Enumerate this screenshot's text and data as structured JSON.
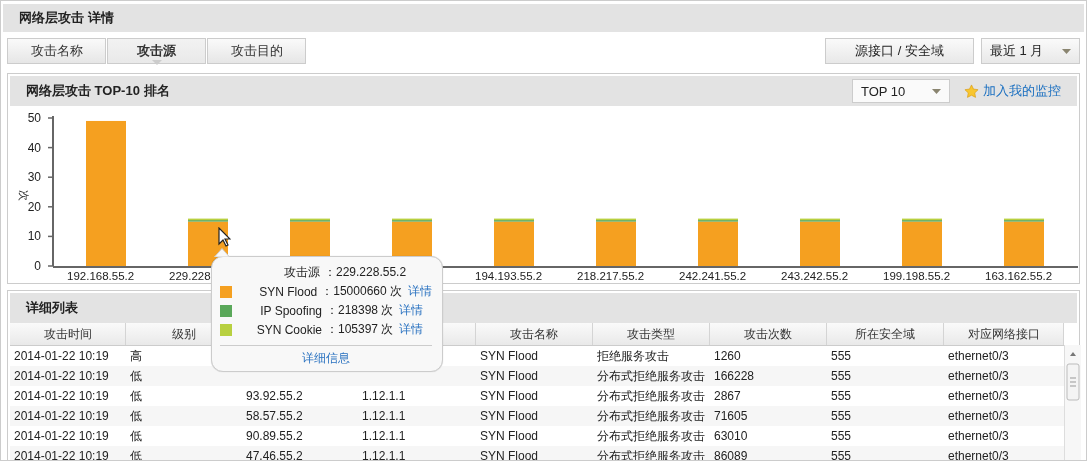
{
  "title": "网络层攻击 详情",
  "tabs": [
    {
      "label": "攻击名称",
      "selected": false
    },
    {
      "label": "攻击源",
      "selected": true
    },
    {
      "label": "攻击目的",
      "selected": false
    }
  ],
  "interface_button": "源接口 / 安全域",
  "period_select": {
    "value": "最近 1 月"
  },
  "chart_panel": {
    "title": "网络层攻击 TOP-10 排名",
    "top_select": {
      "value": "TOP 10"
    },
    "monitor_link": "加入我的监控",
    "chart_data": {
      "type": "bar",
      "stacked": true,
      "ylabel": "次",
      "ylim": [
        0,
        50
      ],
      "yticks": [
        0,
        10,
        20,
        30,
        40,
        50
      ],
      "categories": [
        "192.168.55.2",
        "229.228",
        null,
        null,
        "194.193.55.2",
        "218.217.55.2",
        "242.241.55.2",
        "243.242.55.2",
        "199.198.55.2",
        "163.162.55.2"
      ],
      "series": [
        {
          "name": "SYN Flood",
          "color": "#f5a020",
          "values": [
            49,
            15,
            15,
            15,
            15,
            15,
            15,
            15,
            15,
            15
          ]
        },
        {
          "name": "IP Spoofing",
          "color": "#5aa85a",
          "values": [
            0,
            0.2,
            0.2,
            0.2,
            0.2,
            0.2,
            0.2,
            0.2,
            0.2,
            0.2
          ]
        },
        {
          "name": "SYN Cookie",
          "color": "#b8d040",
          "values": [
            0,
            0.1,
            0.1,
            0.1,
            0.1,
            0.1,
            0.1,
            0.1,
            0.1,
            0.1
          ]
        }
      ]
    }
  },
  "tooltip": {
    "source_label": "攻击源",
    "source_value": "：229.228.55.2",
    "items": [
      {
        "count": "：15000660 次",
        "link": "详情"
      },
      {
        "count": "：218398 次",
        "link": "详情"
      },
      {
        "count": "：105397 次",
        "link": "详情"
      }
    ],
    "more_link": "详细信息"
  },
  "detail_panel": {
    "title": "详细列表",
    "columns": [
      "攻击时间",
      "级别",
      null,
      null,
      "攻击名称",
      "攻击类型",
      "攻击次数",
      "所在安全域",
      "对应网络接口"
    ],
    "rows": [
      [
        "2014-01-22 10:19",
        "高",
        null,
        null,
        "SYN Flood",
        "拒绝服务攻击",
        "1260",
        "555",
        "ethernet0/3"
      ],
      [
        "2014-01-22 10:19",
        "低",
        null,
        null,
        "SYN Flood",
        "分布式拒绝服务攻击",
        "166228",
        "555",
        "ethernet0/3"
      ],
      [
        "2014-01-22 10:19",
        "低",
        "93.92.55.2",
        "1.12.1.1",
        "SYN Flood",
        "分布式拒绝服务攻击",
        "2867",
        "555",
        "ethernet0/3"
      ],
      [
        "2014-01-22 10:19",
        "低",
        "58.57.55.2",
        "1.12.1.1",
        "SYN Flood",
        "分布式拒绝服务攻击",
        "71605",
        "555",
        "ethernet0/3"
      ],
      [
        "2014-01-22 10:19",
        "低",
        "90.89.55.2",
        "1.12.1.1",
        "SYN Flood",
        "分布式拒绝服务攻击",
        "63010",
        "555",
        "ethernet0/3"
      ],
      [
        "2014-01-22 10:19",
        "低",
        "47.46.55.2",
        "1.12.1.1",
        "SYN Flood",
        "分布式拒绝服务攻击",
        "86089",
        "555",
        "ethernet0/3"
      ]
    ]
  }
}
